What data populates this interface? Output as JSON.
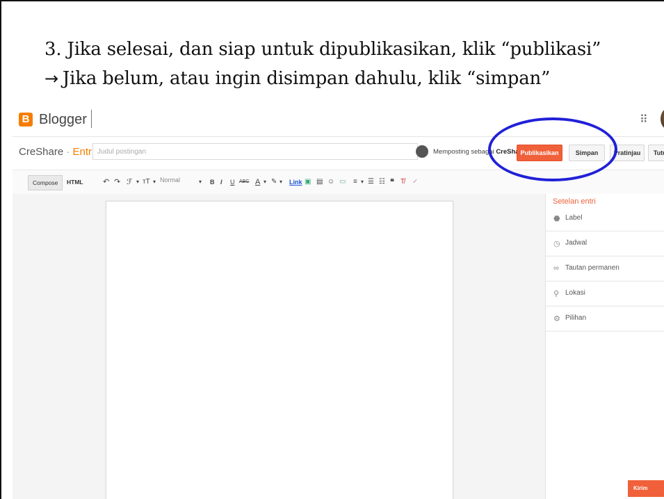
{
  "instructions": {
    "line1": "3. Jika selesai, dan siap untuk dipublikasikan, klik “publikasi”",
    "arrow": "→",
    "line2": "Jika belum, atau ingin disimpan dahulu, klik “simpan”"
  },
  "app": {
    "logo_letter": "B",
    "name": "Blogger"
  },
  "editor_header": {
    "blog_name": "CreShare",
    "separator": " · ",
    "section": "Entri",
    "title_placeholder": "Judul postingan",
    "posting_as": "Memposting sebagai",
    "posting_as_name": "CreShare",
    "buttons": {
      "publish": "Publikasikan",
      "save": "Simpan",
      "preview": "Pratinjau",
      "close": "Tutup"
    }
  },
  "toolbar": {
    "compose": "Compose",
    "html": "HTML",
    "undo": "↶",
    "redo": "↷",
    "font": "ℱ",
    "font_size": "тT",
    "format_value": "Normal",
    "bold": "B",
    "italic": "I",
    "underline": "U",
    "strike": "ABC",
    "text_color": "A",
    "link": "Link",
    "more": "▾"
  },
  "sidebar": {
    "heading": "Setelan entri",
    "items": [
      {
        "icon": "label-icon",
        "glyph": "⬣",
        "label": "Label"
      },
      {
        "icon": "clock-icon",
        "glyph": "◷",
        "label": "Jadwal"
      },
      {
        "icon": "link-icon",
        "glyph": "∞",
        "label": "Tautan permanen"
      },
      {
        "icon": "location-icon",
        "glyph": "⚲",
        "label": "Lokasi"
      },
      {
        "icon": "gear-icon",
        "glyph": "⚙",
        "label": "Pilihan"
      }
    ]
  },
  "feedback": "Kirim masukan",
  "colors": {
    "brand_orange": "#f57d00",
    "publish_button": "#f0603a",
    "highlight_ellipse": "#2020d8"
  }
}
